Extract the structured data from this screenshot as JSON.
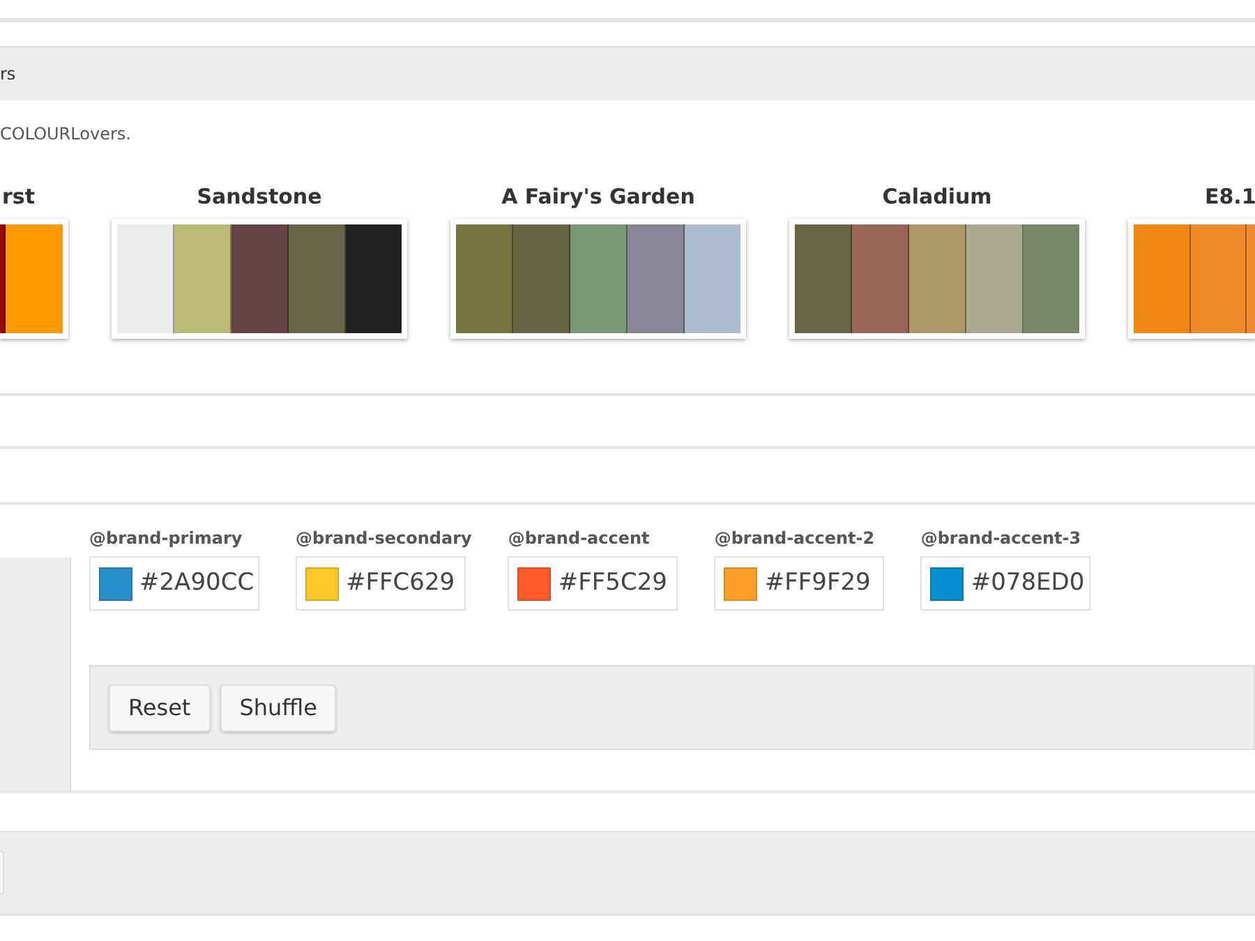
{
  "header": {
    "title": "rs"
  },
  "description": "COLOURLovers.",
  "palettes": [
    {
      "title": "rst",
      "kind": "partial-left",
      "swatches": [
        {
          "color": "#9a0a00"
        },
        {
          "color": "#ff9900"
        }
      ]
    },
    {
      "title": "Sandstone",
      "kind": "full",
      "swatches": [
        {
          "color": "#ececec"
        },
        {
          "color": "#bbba77"
        },
        {
          "color": "#644444"
        },
        {
          "color": "#656645"
        },
        {
          "color": "#222222"
        }
      ]
    },
    {
      "title": "A Fairy's Garden",
      "kind": "full",
      "swatches": [
        {
          "color": "#777641"
        },
        {
          "color": "#646543"
        },
        {
          "color": "#789877"
        },
        {
          "color": "#878797"
        },
        {
          "color": "#aabbcb"
        }
      ]
    },
    {
      "title": "Caladium",
      "kind": "full",
      "swatches": [
        {
          "color": "#676644"
        },
        {
          "color": "#996655"
        },
        {
          "color": "#ac9866"
        },
        {
          "color": "#a9a994"
        },
        {
          "color": "#788866"
        }
      ]
    },
    {
      "title": "E8.1",
      "kind": "partial-right",
      "swatches": [
        {
          "color": "#ef8812"
        },
        {
          "color": "#ee8a27"
        },
        {
          "color": "#ee8a30"
        }
      ]
    }
  ],
  "variables": [
    {
      "label": "@brand-primary",
      "value": "#2A90CC",
      "color": "#2a90cc"
    },
    {
      "label": "@brand-secondary",
      "value": "#FFC629",
      "color": "#ffc629"
    },
    {
      "label": "@brand-accent",
      "value": "#FF5C29",
      "color": "#ff5c29"
    },
    {
      "label": "@brand-accent-2",
      "value": "#FF9F29",
      "color": "#ff9f29"
    },
    {
      "label": "@brand-accent-3",
      "value": "#078ED0",
      "color": "#078ed0"
    }
  ],
  "buttons": [
    "Reset",
    "Shuffle"
  ]
}
